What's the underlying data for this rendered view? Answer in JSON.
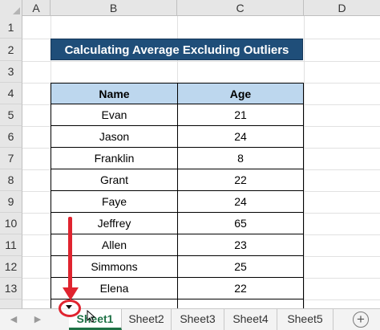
{
  "columns": [
    "A",
    "B",
    "C",
    "D"
  ],
  "rows": [
    "1",
    "2",
    "3",
    "4",
    "5",
    "6",
    "7",
    "8",
    "9",
    "10",
    "11",
    "12",
    "13"
  ],
  "title": "Calculating Average Excluding Outliers",
  "table": {
    "headers": [
      "Name",
      "Age"
    ],
    "rows": [
      [
        "Evan",
        "21"
      ],
      [
        "Jason",
        "24"
      ],
      [
        "Franklin",
        "8"
      ],
      [
        "Grant",
        "22"
      ],
      [
        "Faye",
        "24"
      ],
      [
        "Jeffrey",
        "65"
      ],
      [
        "Allen",
        "23"
      ],
      [
        "Simmons",
        "25"
      ],
      [
        "Elena",
        "22"
      ]
    ]
  },
  "tabs": [
    "Sheet1",
    "Sheet2",
    "Sheet3",
    "Sheet4",
    "Sheet5"
  ],
  "active_tab": "Sheet1",
  "nav": {
    "prev": "◀",
    "next": "▶"
  },
  "add_sheet": "+",
  "colors": {
    "title_bg": "#1f4e79",
    "header_bg": "#bdd7ee",
    "active_tab": "#1e7145",
    "annotation": "#e0242f"
  },
  "icons": [
    "select-all-corner-icon",
    "tab-scroll-left-icon",
    "tab-scroll-right-icon",
    "add-sheet-icon",
    "red-arrow-annotation",
    "dropdown-arrow-icon",
    "mouse-cursor-icon"
  ]
}
